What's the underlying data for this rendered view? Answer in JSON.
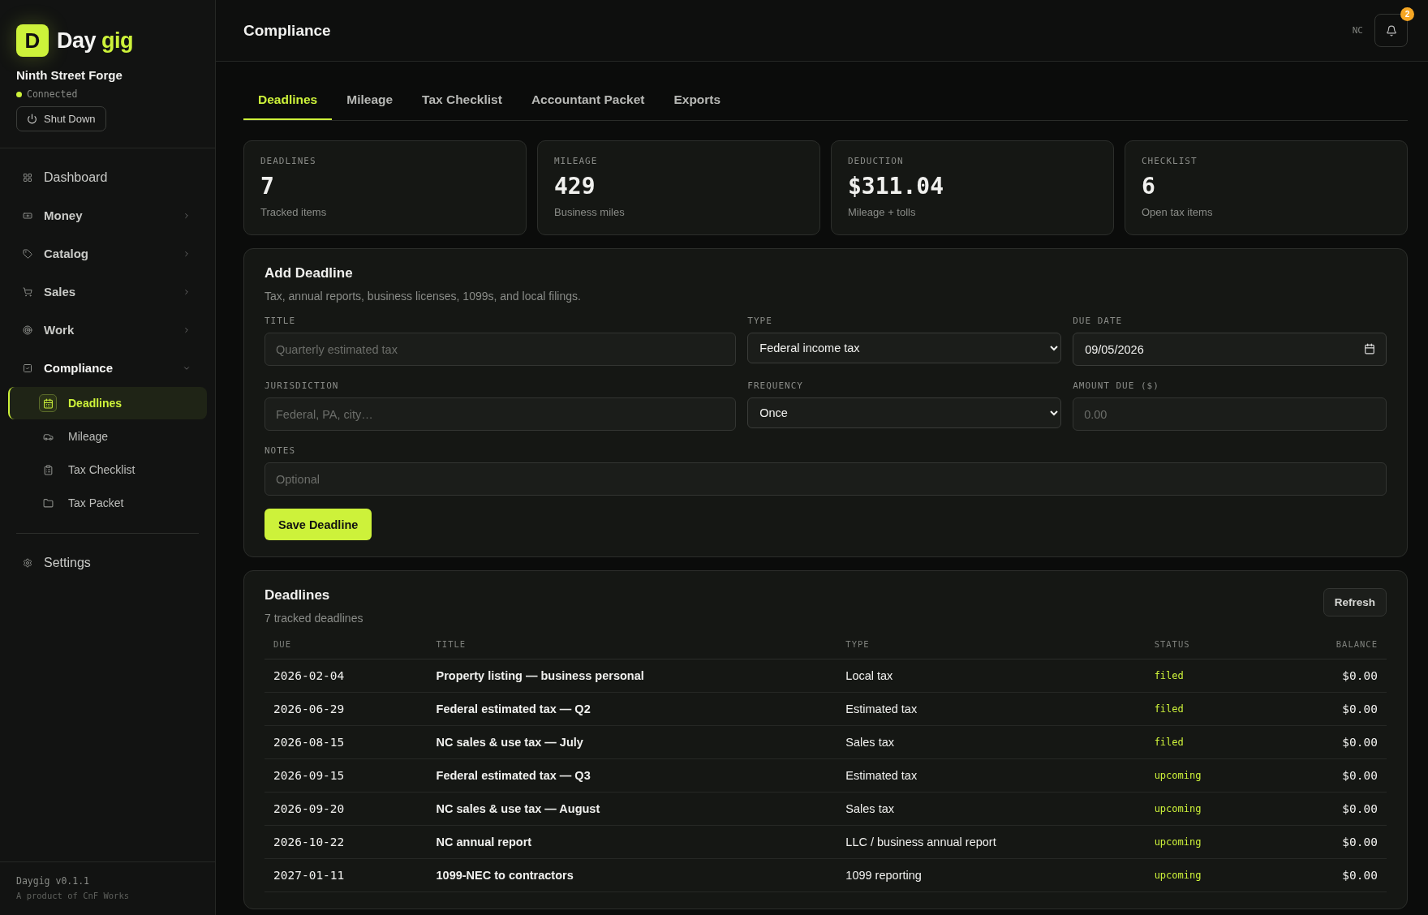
{
  "sidebar": {
    "logo": {
      "mark": "D",
      "word": "Day",
      "accent": "gig"
    },
    "business": "Ninth Street Forge",
    "status": {
      "label": "Connected",
      "on": true
    },
    "shutdown": "Shut Down",
    "nav": [
      {
        "kind": "link",
        "label": "Dashboard"
      },
      {
        "kind": "group",
        "label": "Money",
        "expanded": false
      },
      {
        "kind": "group",
        "label": "Catalog",
        "expanded": false
      },
      {
        "kind": "group",
        "label": "Sales",
        "expanded": false
      },
      {
        "kind": "group",
        "label": "Work",
        "expanded": false
      },
      {
        "kind": "group",
        "label": "Compliance",
        "expanded": true,
        "children": [
          {
            "label": "Deadlines",
            "selected": true
          },
          {
            "label": "Mileage",
            "selected": false
          },
          {
            "label": "Tax Checklist",
            "selected": false
          },
          {
            "label": "Tax Packet",
            "selected": false
          }
        ]
      }
    ],
    "settings": "Settings",
    "version": "Daygig v0.1.1",
    "credit": "A product of CnF Works"
  },
  "header": {
    "title": "Compliance",
    "user": "NC",
    "notifications": "2"
  },
  "tabs": [
    {
      "label": "Deadlines",
      "selected": true
    },
    {
      "label": "Mileage",
      "selected": false
    },
    {
      "label": "Tax Checklist",
      "selected": false
    },
    {
      "label": "Accountant Packet",
      "selected": false
    },
    {
      "label": "Exports",
      "selected": false
    }
  ],
  "stats": [
    {
      "label": "DEADLINES",
      "value": "7",
      "caption": "Tracked items"
    },
    {
      "label": "MILEAGE",
      "value": "429",
      "caption": "Business miles"
    },
    {
      "label": "DEDUCTION",
      "value": "$311.04",
      "caption": "Mileage + tolls"
    },
    {
      "label": "CHECKLIST",
      "value": "6",
      "caption": "Open tax items"
    }
  ],
  "form": {
    "title": "Add Deadline",
    "subtitle": "Tax, annual reports, business licenses, 1099s, and local filings.",
    "fields": [
      {
        "kind": "text",
        "label": "TITLE",
        "placeholder": "Quarterly estimated tax"
      },
      {
        "kind": "select",
        "label": "TYPE",
        "value": "Federal income tax"
      },
      {
        "kind": "date",
        "label": "DUE DATE",
        "value": "09/05/2026"
      },
      {
        "kind": "text",
        "label": "JURISDICTION",
        "placeholder": "Federal, PA, city…"
      },
      {
        "kind": "select",
        "label": "FREQUENCY",
        "value": "Once"
      },
      {
        "kind": "text",
        "label": "AMOUNT DUE ($)",
        "placeholder": "0.00"
      },
      {
        "kind": "wide",
        "label": "NOTES",
        "placeholder": "Optional"
      }
    ],
    "submit": "Save Deadline"
  },
  "table": {
    "title": "Deadlines",
    "subtitle": "7 tracked deadlines",
    "refresh": "Refresh",
    "columns": [
      "DUE",
      "TITLE",
      "TYPE",
      "STATUS",
      "BALANCE"
    ],
    "rows": [
      [
        "2026-02-04",
        "Property listing — business personal",
        "Local tax",
        "filed",
        "$0.00"
      ],
      [
        "2026-06-29",
        "Federal estimated tax — Q2",
        "Estimated tax",
        "filed",
        "$0.00"
      ],
      [
        "2026-08-15",
        "NC sales & use tax — July",
        "Sales tax",
        "filed",
        "$0.00"
      ],
      [
        "2026-09-15",
        "Federal estimated tax — Q3",
        "Estimated tax",
        "upcoming",
        "$0.00"
      ],
      [
        "2026-09-20",
        "NC sales & use tax — August",
        "Sales tax",
        "upcoming",
        "$0.00"
      ],
      [
        "2026-10-22",
        "NC annual report",
        "LLC / business annual report",
        "upcoming",
        "$0.00"
      ],
      [
        "2027-01-11",
        "1099-NEC to contractors",
        "1099 reporting",
        "upcoming",
        "$0.00"
      ]
    ]
  }
}
